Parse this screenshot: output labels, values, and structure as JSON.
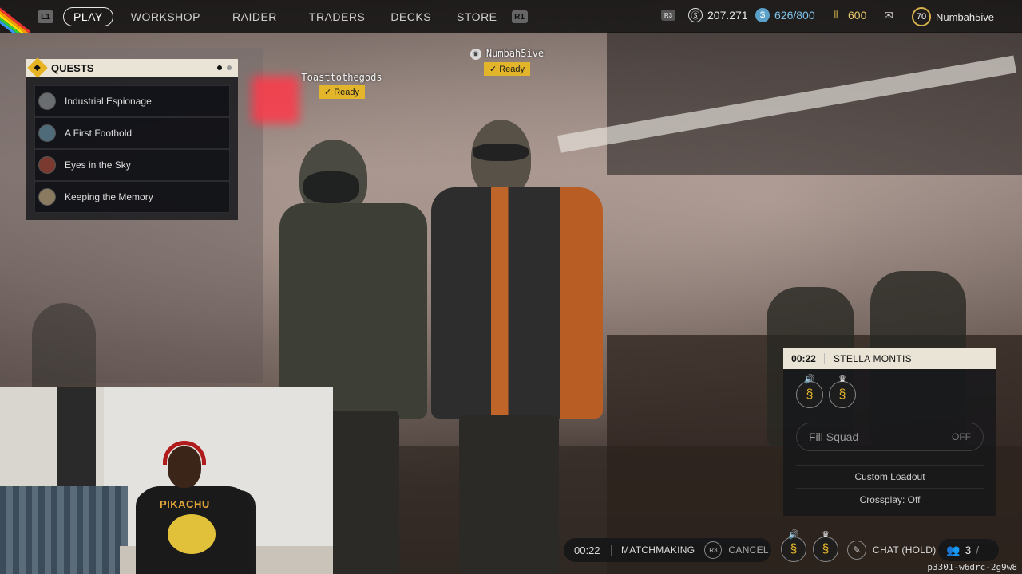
{
  "nav": {
    "l1_hint": "L1",
    "r1_hint": "R1",
    "items": [
      "PLAY",
      "WORKSHOP",
      "RAIDER",
      "TRADERS",
      "DECKS",
      "STORE"
    ],
    "active": "PLAY"
  },
  "currencies": {
    "r3_hint": "R3",
    "coins": "207.271",
    "seeds": "626/800",
    "credits": "600",
    "mail_icon": "mail-icon"
  },
  "player": {
    "level": "70",
    "name": "Numbah5ive"
  },
  "quests": {
    "title": "QUESTS",
    "items": [
      {
        "name": "Industrial Espionage"
      },
      {
        "name": "A First Foothold"
      },
      {
        "name": "Eyes in the Sky"
      },
      {
        "name": "Keeping the Memory"
      }
    ]
  },
  "lobby": {
    "players": [
      {
        "name": "Toasttothegods",
        "status": "Ready"
      },
      {
        "name": "Numbah5ive",
        "status": "Ready"
      }
    ]
  },
  "squad": {
    "timer": "00:22",
    "map": "STELLA MONTIS",
    "fill_label": "Fill Squad",
    "fill_value": "OFF",
    "custom_loadout": "Custom Loadout",
    "crossplay": "Crossplay: Off"
  },
  "matchmaking": {
    "timer": "00:22",
    "label": "MATCHMAKING",
    "r3_hint": "R3",
    "cancel": "CANCEL",
    "chat": "CHAT (HOLD)",
    "party_count": "3"
  },
  "session_id": "p3301-w6drc-2g9w8",
  "webcam": {
    "shirt_text": "PIKACHU"
  },
  "colors": {
    "accent": "#e2b52a",
    "panel_header": "#e9e4d6"
  }
}
